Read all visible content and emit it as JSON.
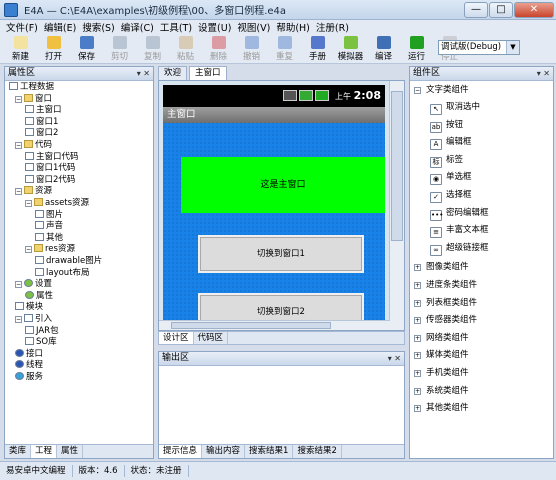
{
  "window": {
    "title": "E4A — C:\\E4A\\examples\\初级例程\\00、多窗口例程.e4a",
    "minimize": "—",
    "maximize": "□",
    "close": "✕"
  },
  "menu": [
    "文件(F)",
    "编辑(E)",
    "搜索(S)",
    "编译(C)",
    "工具(T)",
    "设置(U)",
    "视图(V)",
    "帮助(H)",
    "注册(R)"
  ],
  "toolbar": [
    {
      "label": "新建",
      "icon": "new-file-icon",
      "color": "#f4e3a0",
      "enabled": true
    },
    {
      "label": "打开",
      "icon": "open-folder-icon",
      "color": "#f0c040",
      "enabled": true
    },
    {
      "label": "保存",
      "icon": "save-icon",
      "color": "#4a7cc8",
      "enabled": true
    },
    {
      "label": "剪切",
      "icon": "cut-icon",
      "color": "#8899aa",
      "enabled": false
    },
    {
      "label": "复制",
      "icon": "copy-icon",
      "color": "#8899aa",
      "enabled": false
    },
    {
      "label": "粘贴",
      "icon": "paste-icon",
      "color": "#c9a86a",
      "enabled": false
    },
    {
      "label": "删除",
      "icon": "delete-icon",
      "color": "#d04040",
      "enabled": false
    },
    {
      "label": "撤销",
      "icon": "undo-icon",
      "color": "#4a7cc8",
      "enabled": false
    },
    {
      "label": "重复",
      "icon": "redo-icon",
      "color": "#4a7cc8",
      "enabled": false
    },
    {
      "label": "手册",
      "icon": "manual-icon",
      "color": "#5577cc",
      "enabled": true
    },
    {
      "label": "模拟器",
      "icon": "android-emulator-icon",
      "color": "#7cc242",
      "enabled": true
    },
    {
      "label": "编译",
      "icon": "compile-icon",
      "color": "#3f6fb5",
      "enabled": true
    },
    {
      "label": "运行",
      "icon": "run-icon",
      "color": "#20a020",
      "enabled": true
    },
    {
      "label": "停止",
      "icon": "stop-icon",
      "color": "#b0b0b0",
      "enabled": false
    }
  ],
  "mode_select": {
    "value": "调试版(Debug)",
    "arrow": "▼"
  },
  "left_panel": {
    "title": "属性区",
    "pins": "▾ ✕",
    "tree": [
      {
        "label": "工程数据",
        "level": 0,
        "toggle": "",
        "icon": "project-icon"
      },
      {
        "label": "窗口",
        "level": 1,
        "toggle": "−",
        "icon": "folder-icon"
      },
      {
        "label": "主窗口",
        "level": 2,
        "toggle": "",
        "icon": "window-icon"
      },
      {
        "label": "窗口1",
        "level": 2,
        "toggle": "",
        "icon": "window-icon"
      },
      {
        "label": "窗口2",
        "level": 2,
        "toggle": "",
        "icon": "window-icon"
      },
      {
        "label": "代码",
        "level": 1,
        "toggle": "−",
        "icon": "folder-icon"
      },
      {
        "label": "主窗口代码",
        "level": 2,
        "toggle": "",
        "icon": "code-icon"
      },
      {
        "label": "窗口1代码",
        "level": 2,
        "toggle": "",
        "icon": "code-icon"
      },
      {
        "label": "窗口2代码",
        "level": 2,
        "toggle": "",
        "icon": "code-icon"
      },
      {
        "label": "资源",
        "level": 1,
        "toggle": "−",
        "icon": "folder-icon"
      },
      {
        "label": "assets资源",
        "level": 2,
        "toggle": "−",
        "icon": "folder-icon"
      },
      {
        "label": "图片",
        "level": 3,
        "toggle": "",
        "icon": "image-icon"
      },
      {
        "label": "声音",
        "level": 3,
        "toggle": "",
        "icon": "sound-icon"
      },
      {
        "label": "其他",
        "level": 3,
        "toggle": "",
        "icon": "question-icon"
      },
      {
        "label": "res资源",
        "level": 2,
        "toggle": "−",
        "icon": "folder-icon"
      },
      {
        "label": "drawable图片",
        "level": 3,
        "toggle": "",
        "icon": "image-icon"
      },
      {
        "label": "layout布局",
        "level": 3,
        "toggle": "",
        "icon": "layout-icon"
      },
      {
        "label": "设置",
        "level": 1,
        "toggle": "−",
        "icon": "settings-icon"
      },
      {
        "label": "属性",
        "level": 2,
        "toggle": "",
        "icon": "gear-icon"
      },
      {
        "label": "模块",
        "level": 1,
        "toggle": "",
        "icon": "module-icon"
      },
      {
        "label": "引入",
        "level": 1,
        "toggle": "−",
        "icon": "import-icon"
      },
      {
        "label": "JAR包",
        "level": 2,
        "toggle": "",
        "icon": "jar-icon"
      },
      {
        "label": "SO库",
        "level": 2,
        "toggle": "",
        "icon": "so-icon"
      },
      {
        "label": "接口",
        "level": 1,
        "toggle": "",
        "icon": "interface-icon"
      },
      {
        "label": "线程",
        "level": 1,
        "toggle": "",
        "icon": "thread-icon"
      },
      {
        "label": "服务",
        "level": 1,
        "toggle": "",
        "icon": "service-icon"
      }
    ],
    "tabs": [
      "类库",
      "工程",
      "属性"
    ]
  },
  "doc_tabs": [
    "欢迎",
    "主窗口"
  ],
  "phone": {
    "time": "2:08",
    "ampm": "上午",
    "form_title": "主窗口",
    "label_text": "这是主窗口",
    "button1": "切换到窗口1",
    "button2": "切换到窗口2",
    "label_color": "#00ff00",
    "background": "#1882e8"
  },
  "view_tabs": [
    "设计区",
    "代码区"
  ],
  "output_panel": {
    "title": "输出区",
    "pins": "▾ ✕",
    "tabs": [
      "提示信息",
      "输出内容",
      "搜索结果1",
      "搜索结果2"
    ]
  },
  "right_panel": {
    "title": "组件区",
    "pins": "▾ ✕",
    "groups_top": "文字类组件",
    "items": [
      {
        "label": "取消选中",
        "icon": "cursor-icon",
        "glyph": "↖"
      },
      {
        "label": "按钮",
        "icon": "button-icon",
        "glyph": "ab"
      },
      {
        "label": "编辑框",
        "icon": "edit-box-icon",
        "glyph": "A"
      },
      {
        "label": "标签",
        "icon": "label-icon",
        "glyph": "标"
      },
      {
        "label": "单选框",
        "icon": "radio-icon",
        "glyph": "◉"
      },
      {
        "label": "选择框",
        "icon": "checkbox-icon",
        "glyph": "✓"
      },
      {
        "label": "密码编辑框",
        "icon": "password-icon",
        "glyph": "•••"
      },
      {
        "label": "丰富文本框",
        "icon": "rich-text-icon",
        "glyph": "≡"
      },
      {
        "label": "超级链接框",
        "icon": "hyperlink-icon",
        "glyph": "∞"
      }
    ],
    "groups": [
      "图像类组件",
      "进度条类组件",
      "列表框类组件",
      "传感器类组件",
      "网络类组件",
      "媒体类组件",
      "手机类组件",
      "系统类组件",
      "其他类组件"
    ]
  },
  "status": [
    "易安卓中文编程",
    "版本：4.6",
    "状态：未注册"
  ]
}
